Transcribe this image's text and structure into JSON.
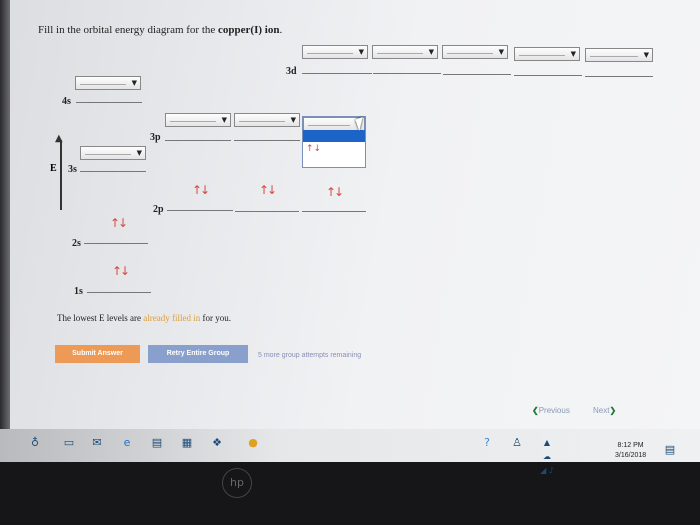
{
  "question": {
    "prefix": "Fill in the orbital energy diagram for the ",
    "bold": "copper(I) ion",
    "suffix": "."
  },
  "axis_label": "E",
  "levels": {
    "l3d": "3d",
    "l4s": "4s",
    "l3p": "3p",
    "l3s": "3s",
    "l2p": "2p",
    "l2s": "2s",
    "l1s": "1s"
  },
  "filled_arrows": "↑↓",
  "dropdown_open_option": "↑↓",
  "note": {
    "prefix": "The lowest E levels are ",
    "highlight": "already filled in",
    "suffix": " for you."
  },
  "buttons": {
    "submit": "Submit Answer",
    "retry": "Retry Entire Group"
  },
  "attempts_text": "5 more group attempts remaining",
  "nav": {
    "previous": "Previous",
    "next": "Next"
  },
  "clock": {
    "time": "8:12 PM",
    "date": "3/16/2018"
  },
  "colors": {
    "arrow": "#d9453e",
    "submit": "#ec9a55",
    "retry": "#8aa0cc",
    "dropdown_highlight": "#1d64c8"
  }
}
